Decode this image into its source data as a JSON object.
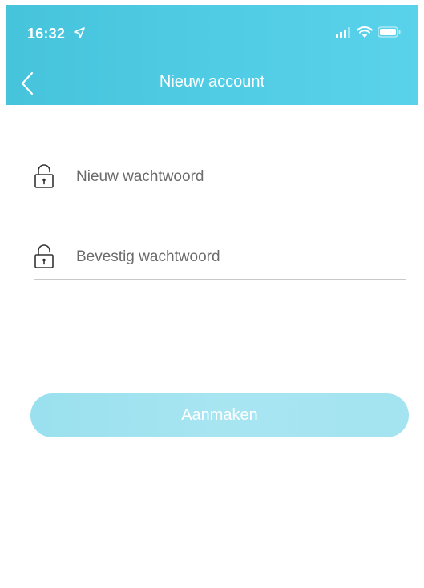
{
  "status_bar": {
    "time": "16:32",
    "icons": [
      "location-arrow-icon",
      "signal-icon",
      "wifi-icon",
      "battery-icon"
    ]
  },
  "nav": {
    "title": "Nieuw account",
    "back_icon": "chevron-left-icon"
  },
  "form": {
    "new_password": {
      "value": "",
      "placeholder": "Nieuw wachtwoord",
      "icon": "lock-icon"
    },
    "confirm_password": {
      "value": "",
      "placeholder": "Bevestig wachtwoord",
      "icon": "lock-icon"
    },
    "submit_label": "Aanmaken",
    "submit_enabled": false
  },
  "colors": {
    "header": "#4fcae3",
    "button_disabled": "#a3e4f0",
    "underline": "#c9c9c9"
  }
}
